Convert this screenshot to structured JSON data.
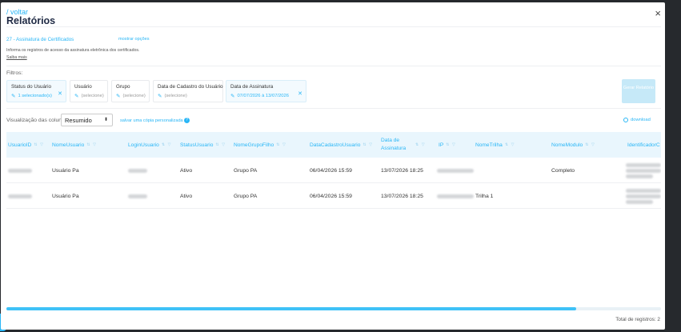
{
  "header": {
    "back": "/ voltar",
    "title": "Relatórios",
    "close": "×"
  },
  "report": {
    "name": "27 - Assinatura de Certificados",
    "show_options": "mostrar opções",
    "description": "Informa os registros de acesso da assinatura eletrônica dos certificados.",
    "more": "Saiba mais"
  },
  "filters": {
    "label": "Filtros:",
    "chips": [
      {
        "title": "Status do Usuário",
        "value": "1 selecionado(s)",
        "selected": true
      },
      {
        "title": "Usuário",
        "value": "(selecione)",
        "selected": false
      },
      {
        "title": "Grupo",
        "value": "(selecione)",
        "selected": false
      },
      {
        "title": "Data de Cadastro do Usuário",
        "value": "(selecione)",
        "selected": false
      },
      {
        "title": "Data de Assinatura",
        "value": "07/07/2026 à 13/07/2026",
        "selected": true
      }
    ],
    "generate_button": "Gerar Relatório"
  },
  "view": {
    "label": "Visualização das colunas:",
    "selected": "Resumido",
    "custom_link": "salvar uma cópia personalizada",
    "download": "download"
  },
  "table": {
    "columns": [
      "UsuarioID",
      "NomeUsuario",
      "LoginUsuario",
      "StatusUsuario",
      "NomeGrupoFilho",
      "DataCadastroUsuario",
      "Data de Assinatura",
      "IP",
      "NomeTrilha",
      "NomeModulo",
      "IdentificadorC"
    ],
    "rows": [
      {
        "nome": "Usuário Pa",
        "status": "Ativo",
        "grupo": "Grupo PA",
        "cadastro": "06/04/2026 15:59",
        "assinatura": "13/07/2026 18:25",
        "trilha": "",
        "modulo": "Completo"
      },
      {
        "nome": "Usuário Pa",
        "status": "Ativo",
        "grupo": "Grupo PA",
        "cadastro": "06/04/2026 15:59",
        "assinatura": "13/07/2026 18:25",
        "trilha": "Trilha 1",
        "modulo": ""
      }
    ]
  },
  "scroll": {
    "position": 0.87
  },
  "footer": {
    "total": "Total de registros: 2"
  },
  "colors": {
    "accent": "#29b6f6",
    "header_bg": "#e9f6fd",
    "title": "#1f2a44"
  }
}
